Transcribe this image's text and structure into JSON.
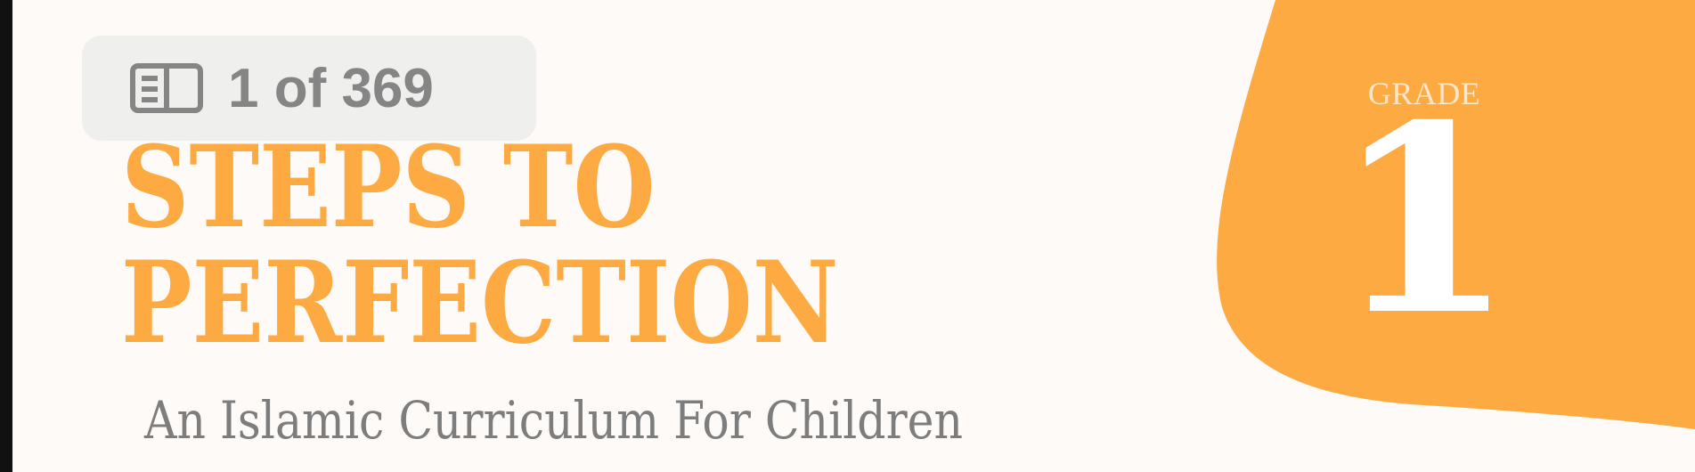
{
  "document": {
    "title_line_1": "STEPS TO",
    "title_line_2": "PERFECTION",
    "subtitle": "An Islamic Curriculum For Children",
    "grade_label": "GRADE",
    "grade_number": "1"
  },
  "page_indicator": {
    "icon": "book-pages-icon",
    "text": "1 of 369"
  },
  "colors": {
    "accent_orange": "#fdaa43",
    "page_background": "#fdfaf7",
    "viewer_background": "#111111",
    "subtitle_gray": "#7d7d7d",
    "badge_text_gray": "#858585"
  }
}
